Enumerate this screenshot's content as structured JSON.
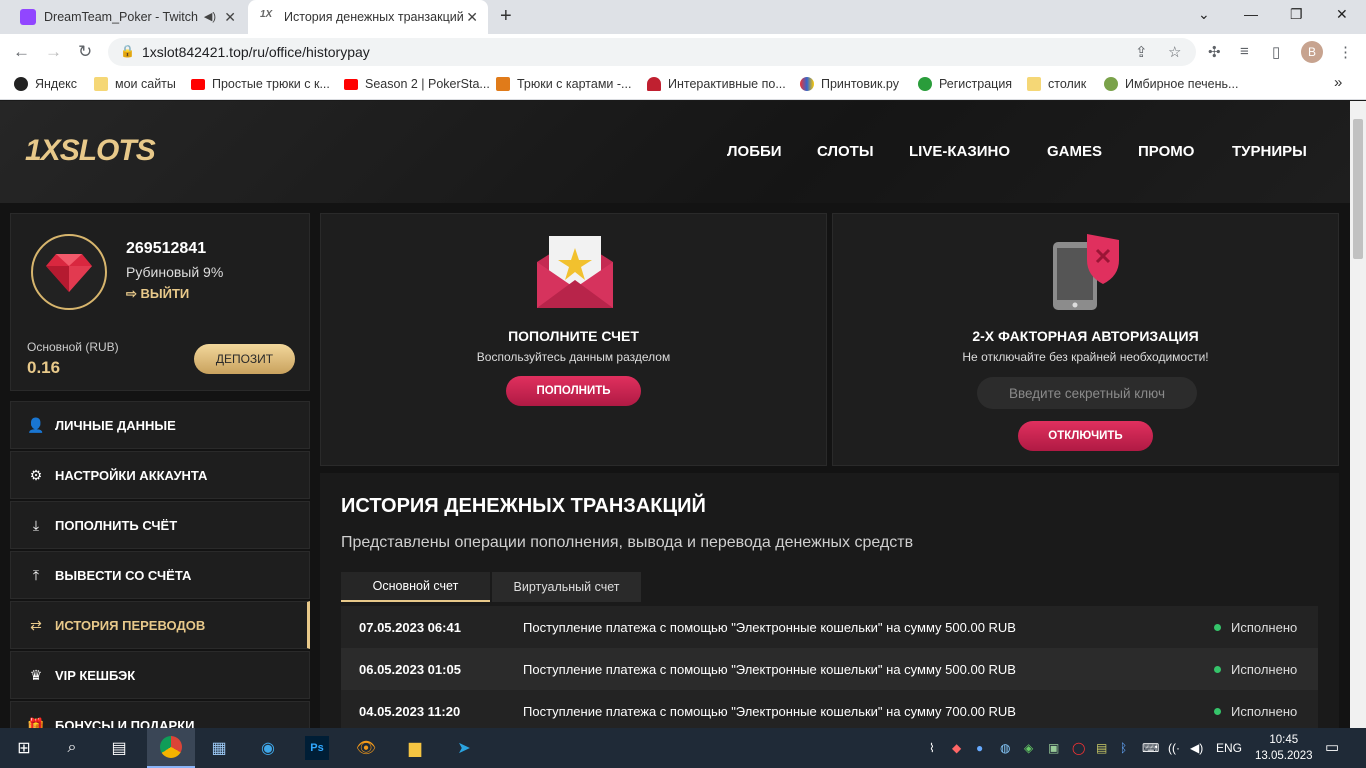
{
  "browser": {
    "tabs": [
      {
        "title": "DreamTeam_Poker - Twitch",
        "favicon": "twitch-icon",
        "active": false
      },
      {
        "title": "История денежных транзакций",
        "favicon": "1x-icon",
        "active": true
      }
    ],
    "url": "1xslot842421.top/ru/office/historypay",
    "profile_initial": "B",
    "bookmarks": [
      {
        "label": "Яндекс",
        "icon": "yandex-icon"
      },
      {
        "label": "мои сайты",
        "icon": "folder-icon"
      },
      {
        "label": "Простые трюки с к...",
        "icon": "youtube-icon"
      },
      {
        "label": "Season 2 | PokerSta...",
        "icon": "youtube-icon"
      },
      {
        "label": "Трюки с картами -...",
        "icon": "cards-icon"
      },
      {
        "label": "Интерактивные по...",
        "icon": "spade-icon"
      },
      {
        "label": "Принтовик.ру",
        "icon": "printovik-icon"
      },
      {
        "label": "Регистрация",
        "icon": "green-g-icon"
      },
      {
        "label": "столик",
        "icon": "folder-icon"
      },
      {
        "label": "Имбирное печень...",
        "icon": "gingerbread-icon"
      }
    ],
    "more_bookmarks": "»"
  },
  "site": {
    "logo": "1XSLOTS",
    "nav": [
      "ЛОББИ",
      "СЛОТЫ",
      "LIVE-КАЗИНО",
      "GAMES",
      "ПРОМО",
      "ТУРНИРЫ"
    ],
    "profile": {
      "user_id": "269512841",
      "level": "Рубиновый 9%",
      "logout": "ВЫЙТИ",
      "account_label": "Основной (RUB)",
      "balance": "0.16",
      "deposit_button": "ДЕПОЗИТ"
    },
    "menu": [
      {
        "label": "ЛИЧНЫЕ ДАННЫЕ",
        "icon": "user-edit-icon"
      },
      {
        "label": "НАСТРОЙКИ АККАУНТА",
        "icon": "gears-icon"
      },
      {
        "label": "ПОПОЛНИТЬ СЧЁТ",
        "icon": "download-icon"
      },
      {
        "label": "ВЫВЕСТИ СО СЧЁТА",
        "icon": "upload-icon"
      },
      {
        "label": "ИСТОРИЯ ПЕРЕВОДОВ",
        "icon": "transfer-icon",
        "active": true
      },
      {
        "label": "VIP КЕШБЭК",
        "icon": "crown-icon"
      },
      {
        "label": "БОНУСЫ И ПОДАРКИ",
        "icon": "gift-icon"
      }
    ],
    "deposit_card": {
      "title": "ПОПОЛНИТЕ СЧЕТ",
      "subtitle": "Воспользуйтесь данным разделом",
      "button": "ПОПОЛНИТЬ"
    },
    "twofa_card": {
      "title": "2-Х ФАКТОРНАЯ АВТОРИЗАЦИЯ",
      "subtitle": "Не отключайте без крайней необходимости!",
      "input_placeholder": "Введите секретный ключ",
      "button": "ОТКЛЮЧИТЬ"
    },
    "history": {
      "title": "ИСТОРИЯ ДЕНЕЖНЫХ ТРАНЗАКЦИЙ",
      "description": "Представлены операции пополнения, вывода и перевода денежных средств",
      "tabs": [
        "Основной счет",
        "Виртуальный счет"
      ],
      "rows": [
        {
          "date": "07.05.2023 06:41",
          "text": "Поступление платежа с помощью \"Электронные кошельки\" на сумму 500.00 RUB",
          "status": "Исполнено"
        },
        {
          "date": "06.05.2023 01:05",
          "text": "Поступление платежа с помощью \"Электронные кошельки\" на сумму 500.00 RUB",
          "status": "Исполнено"
        },
        {
          "date": "04.05.2023 11:20",
          "text": "Поступление платежа с помощью \"Электронные кошельки\" на сумму 700.00 RUB",
          "status": "Исполнено"
        }
      ]
    }
  },
  "taskbar": {
    "lang": "ENG",
    "time": "10:45",
    "date": "13.05.2023"
  },
  "colors": {
    "accent_gold": "#e8c98a",
    "button_red": "#c8234f",
    "status_green": "#35c46a"
  }
}
